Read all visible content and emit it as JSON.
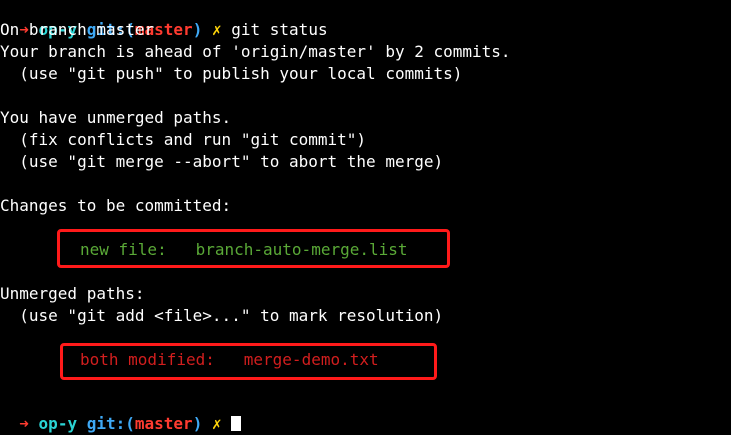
{
  "prompt1": {
    "arrow": "➜",
    "dir": "op-y",
    "git_label": "git:(",
    "branch": "master",
    "git_close": ")",
    "dirty": "✗",
    "command": "git status"
  },
  "output": {
    "on_branch": "On branch master",
    "ahead": "Your branch is ahead of 'origin/master' by 2 commits.",
    "push_hint": "  (use \"git push\" to publish your local commits)",
    "unmerged_header": "You have unmerged paths.",
    "fix_hint": "  (fix conflicts and run \"git commit\")",
    "abort_hint": "  (use \"git merge --abort\" to abort the merge)",
    "changes_header": "Changes to be committed:",
    "new_file_label": "new file:   ",
    "new_file_name": "branch-auto-merge.list",
    "unmerged_paths_header": "Unmerged paths:",
    "add_hint": "  (use \"git add <file>...\" to mark resolution)",
    "modified_label": "both modified:   ",
    "modified_name": "merge-demo.txt"
  },
  "prompt2": {
    "arrow": "➜",
    "dir": "op-y",
    "git_label": "git:(",
    "branch": "master",
    "git_close": ")",
    "dirty": "✗"
  },
  "colors": {
    "background": "#000000",
    "prompt_arrow": "#ff3b30",
    "prompt_dir": "#2bd4d4",
    "prompt_git": "#3fa9f5",
    "staged": "#5aa937",
    "unmerged": "#d21e1e",
    "highlight_box": "#ff1a1a"
  }
}
